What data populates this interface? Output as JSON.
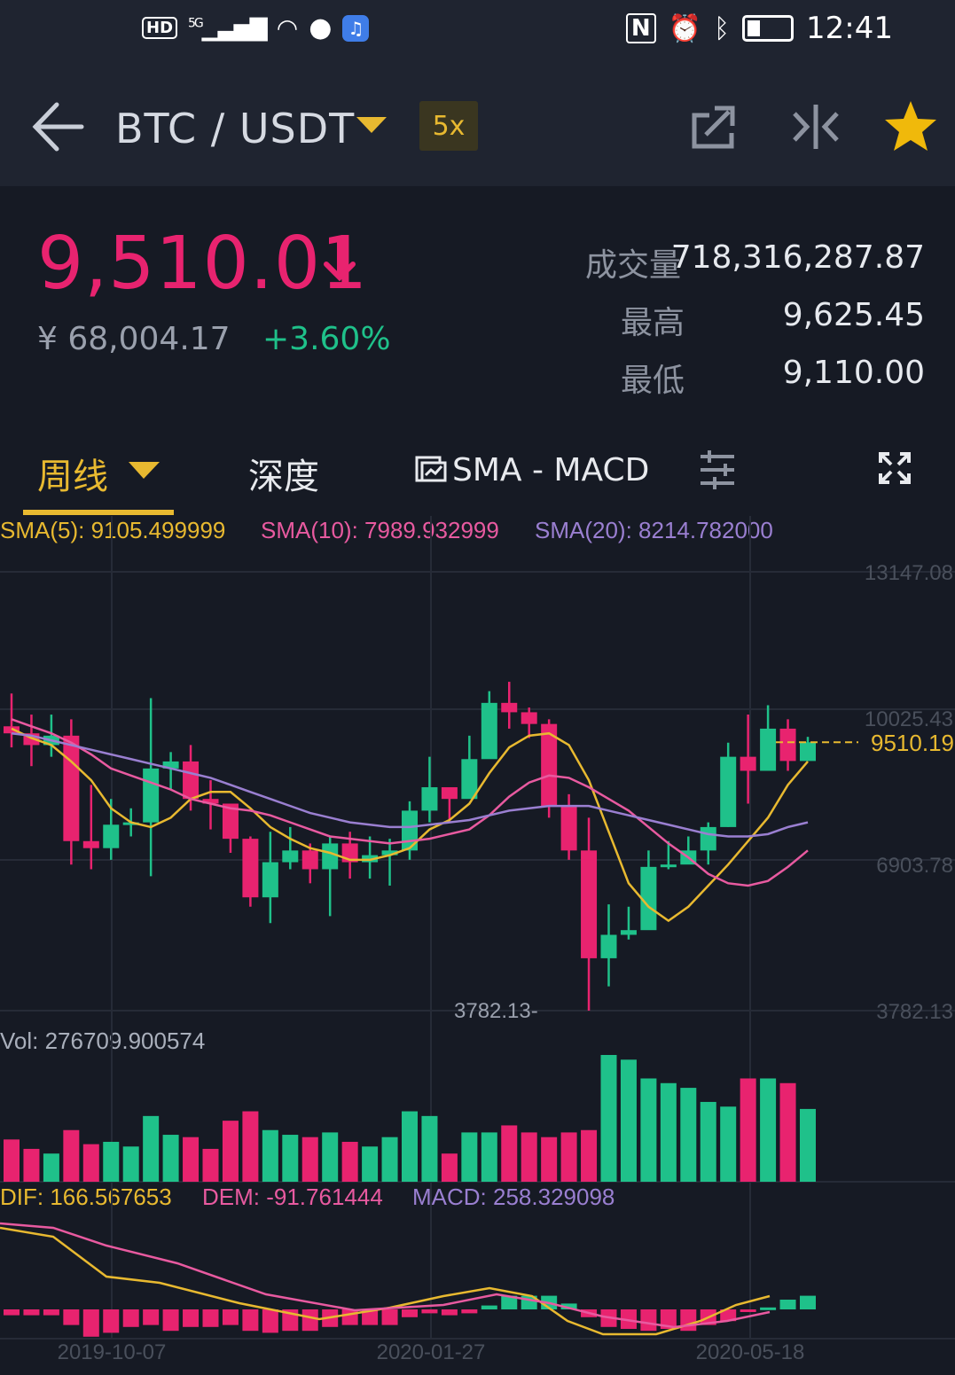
{
  "status": {
    "time": "12:41",
    "network": "5G",
    "hd": "HD"
  },
  "header": {
    "pair": "BTC / USDT",
    "leverage": "5x"
  },
  "quote": {
    "price": "9,510.01",
    "cny": "¥ 68,004.17",
    "change": "+3.60%",
    "volume_label": "成交量",
    "volume_value": "718,316,287.87",
    "high_label": "最高",
    "high_value": "9,625.45",
    "low_label": "最低",
    "low_value": "9,110.00"
  },
  "tabs": {
    "interval": "周线",
    "depth": "深度",
    "indicators": "SMA - MACD"
  },
  "legend": {
    "sma5": "SMA(5): 9105.499999",
    "sma10": "SMA(10): 7989.932999",
    "sma20": "SMA(20): 8214.782000",
    "vol": "Vol: 276709.900574",
    "dif": "DIF: 166.567653",
    "dem": "DEM: -91.761444",
    "macd": "MACD: 258.329098"
  },
  "axis": {
    "y_labels": [
      "13147.08",
      "10025.43",
      "6903.78",
      "3782.13"
    ],
    "x_labels": [
      "2019-10-07",
      "2020-01-27",
      "2020-05-18"
    ],
    "last_price_tag": "9510.19",
    "min_marker": "3782.13"
  },
  "colors": {
    "up": "#1fc18a",
    "down": "#e8236f",
    "sma5": "#e8b930",
    "sma10": "#e85aa0",
    "sma20": "#9a7fd1",
    "accent": "#e8b930"
  },
  "chart_data": [
    {
      "type": "candlestick",
      "ylim": [
        3782.13,
        13147.08
      ],
      "ohlc": [
        [
          9850,
          9700,
          10550,
          9400
        ],
        [
          9700,
          9450,
          10100,
          9000
        ],
        [
          9450,
          9650,
          10100,
          9200
        ],
        [
          9650,
          7400,
          10000,
          6900
        ],
        [
          7400,
          7250,
          8600,
          6800
        ],
        [
          7250,
          7750,
          8300,
          7000
        ],
        [
          7750,
          7800,
          8100,
          7500
        ],
        [
          7800,
          8950,
          10450,
          6650
        ],
        [
          8950,
          9100,
          9300,
          8500
        ],
        [
          9100,
          8300,
          9450,
          8050
        ],
        [
          8300,
          8200,
          8700,
          7650
        ],
        [
          8200,
          7450,
          8000,
          7150
        ],
        [
          7450,
          6200,
          7500,
          6000
        ],
        [
          6200,
          6950,
          7600,
          5650
        ],
        [
          6950,
          7200,
          7700,
          6800
        ],
        [
          7200,
          6800,
          7350,
          6500
        ],
        [
          6800,
          7350,
          7500,
          5800
        ],
        [
          7350,
          6950,
          7600,
          6600
        ],
        [
          6950,
          7100,
          7500,
          6600
        ],
        [
          7100,
          7200,
          7450,
          6450
        ],
        [
          7200,
          8050,
          8250,
          7000
        ],
        [
          8050,
          8550,
          9200,
          7800
        ],
        [
          8550,
          8300,
          8550,
          7800
        ],
        [
          8300,
          9150,
          9650,
          8550
        ],
        [
          9150,
          10350,
          10600,
          10000
        ],
        [
          10350,
          10150,
          10800,
          9800
        ],
        [
          10150,
          9900,
          10250,
          9600
        ],
        [
          9900,
          8150,
          10000,
          7900
        ],
        [
          8150,
          7200,
          8400,
          7000
        ],
        [
          7200,
          4900,
          7900,
          3782
        ],
        [
          4900,
          5400,
          6050,
          4300
        ],
        [
          5400,
          5500,
          6000,
          5300
        ],
        [
          5500,
          6850,
          7200,
          6600
        ],
        [
          6850,
          6900,
          7400,
          6800
        ],
        [
          6900,
          7200,
          7500,
          7050
        ],
        [
          7200,
          7700,
          7800,
          6900
        ],
        [
          7700,
          9200,
          9500,
          7700
        ],
        [
          9200,
          8900,
          10100,
          8200
        ],
        [
          8900,
          9800,
          10300,
          9000
        ],
        [
          9800,
          9110,
          10000,
          8900
        ],
        [
          9110,
          9510,
          9625,
          9110
        ]
      ],
      "series": [
        {
          "name": "SMA(5)",
          "values": [
            9800,
            9600,
            9450,
            9100,
            8700,
            8100,
            7800,
            7700,
            7900,
            8300,
            8450,
            8450,
            8100,
            7700,
            7450,
            7250,
            7150,
            7000,
            7000,
            7100,
            7250,
            7650,
            7850,
            8200,
            8850,
            9400,
            9650,
            9700,
            9450,
            8700,
            7600,
            6500,
            6000,
            5700,
            6000,
            6450,
            6900,
            7400,
            7900,
            8600,
            9100
          ]
        },
        {
          "name": "SMA(10)",
          "values": [
            10000,
            9850,
            9700,
            9500,
            9250,
            8950,
            8800,
            8650,
            8500,
            8300,
            8200,
            8100,
            8050,
            7950,
            7800,
            7650,
            7500,
            7450,
            7400,
            7350,
            7400,
            7450,
            7550,
            7650,
            7950,
            8350,
            8650,
            8800,
            8750,
            8550,
            8300,
            8050,
            7700,
            7350,
            7050,
            6700,
            6500,
            6450,
            6550,
            6850,
            7200
          ]
        },
        {
          "name": "SMA(20)",
          "values": [
            9700,
            9650,
            9550,
            9450,
            9350,
            9250,
            9150,
            9050,
            8950,
            8850,
            8750,
            8600,
            8450,
            8300,
            8150,
            8000,
            7900,
            7800,
            7750,
            7700,
            7700,
            7750,
            7800,
            7850,
            7950,
            8050,
            8100,
            8150,
            8150,
            8150,
            8050,
            7950,
            7850,
            7750,
            7650,
            7550,
            7500,
            7500,
            7550,
            7700,
            7800
          ]
        }
      ]
    },
    {
      "type": "bar",
      "title": "Vol",
      "values": [
        18,
        14,
        12,
        22,
        16,
        17,
        15,
        28,
        20,
        19,
        14,
        26,
        30,
        22,
        20,
        19,
        21,
        17,
        15,
        19,
        30,
        28,
        12,
        21,
        21,
        24,
        21,
        19,
        21,
        22,
        54,
        52,
        44,
        42,
        40,
        34,
        32,
        44,
        44,
        42,
        31,
        19
      ]
    },
    {
      "type": "bar",
      "title": "MACD",
      "values": [
        -3,
        -3,
        -3,
        -8,
        -14,
        -12,
        -9,
        -8,
        -11,
        -9,
        -9,
        -8,
        -11,
        -12,
        -11,
        -11,
        -9,
        -8,
        -8,
        -8,
        -4,
        -2,
        -3,
        -2,
        2,
        7,
        7,
        7,
        3,
        -4,
        -9,
        -10,
        -11,
        -10,
        -11,
        -8,
        -6,
        -1,
        1,
        5,
        7,
        9,
        9
      ]
    }
  ]
}
